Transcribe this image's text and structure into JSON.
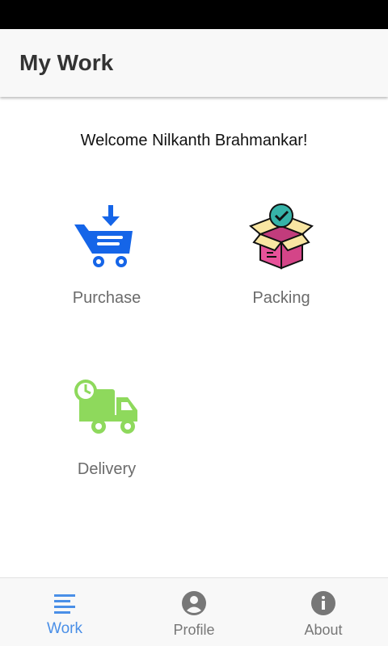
{
  "app_bar": {
    "title": "My Work"
  },
  "welcome_text": "Welcome Nilkanth Brahmankar!",
  "tiles": [
    {
      "label": "Purchase",
      "icon": "shopping-cart-download-icon"
    },
    {
      "label": "Packing",
      "icon": "open-box-check-icon"
    },
    {
      "label": "Delivery",
      "icon": "delivery-truck-clock-icon"
    }
  ],
  "bottom_nav": {
    "items": [
      {
        "label": "Work",
        "icon": "list-icon",
        "active": true
      },
      {
        "label": "Profile",
        "icon": "account-circle-icon",
        "active": false
      },
      {
        "label": "About",
        "icon": "info-icon",
        "active": false
      }
    ]
  },
  "colors": {
    "accent": "#4a8fe7",
    "purchase_blue": "#1565e8",
    "delivery_green": "#8ed95c",
    "box_pink": "#e8529a",
    "box_yellow": "#f9e6a2",
    "check_teal": "#36b3a8"
  }
}
